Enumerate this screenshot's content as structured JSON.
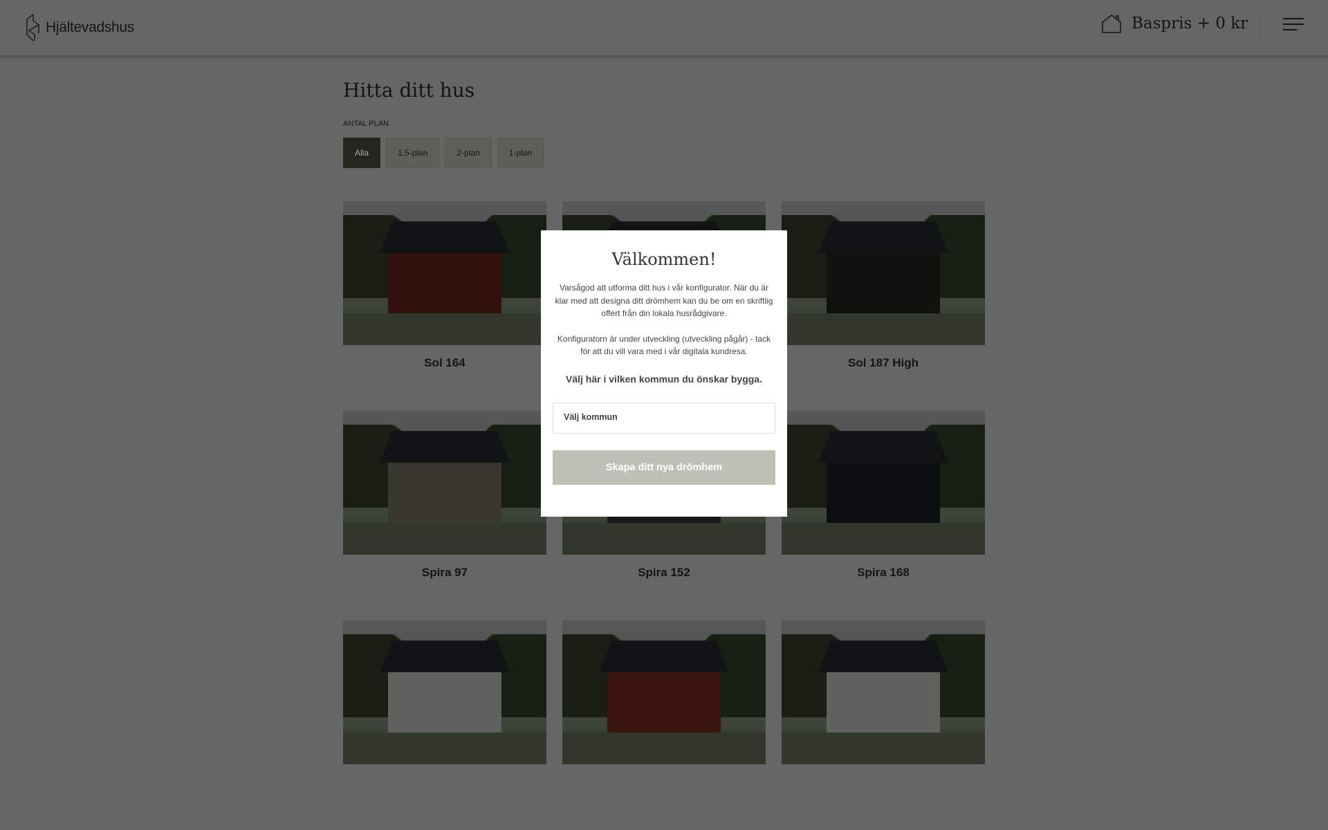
{
  "header": {
    "brand": "Hjältevadshus",
    "price_label": "Baspris + 0 kr"
  },
  "main": {
    "title": "Hitta ditt hus",
    "filter_label": "ANTAL PLAN",
    "filters": [
      "Alla",
      "1,5-plan",
      "2-plan",
      "1-plan"
    ],
    "active_filter": "Alla"
  },
  "houses": [
    {
      "name": "Sol 164",
      "wall": "#7a2b1f"
    },
    {
      "name": "",
      "wall": "#e8e6e0"
    },
    {
      "name": "Sol 187 High",
      "wall": "#2b2a28"
    },
    {
      "name": "Spira 97",
      "wall": "#8c8a78"
    },
    {
      "name": "Spira 152",
      "wall": "#3a3d44"
    },
    {
      "name": "Spira 168",
      "wall": "#1f2229"
    },
    {
      "name": "",
      "wall": "#efefed"
    },
    {
      "name": "",
      "wall": "#8e3323"
    },
    {
      "name": "",
      "wall": "#f2f2f0"
    }
  ],
  "modal": {
    "title": "Välkommen!",
    "p1": "Varsågod att utforma ditt hus i vår konfigurator. När du är klar med att designa ditt drömhem kan du be om en skriftlig offert från din lokala husrådgivare.",
    "p2": "Konfiguratorn är under utveckling (utveckling pågår) - tack för att du vill vara med i vår digitala kundresa.",
    "question": "Välj här i vilken kommun du önskar bygga.",
    "select_placeholder": "Välj kommun",
    "cta": "Skapa ditt nya drömhem"
  }
}
